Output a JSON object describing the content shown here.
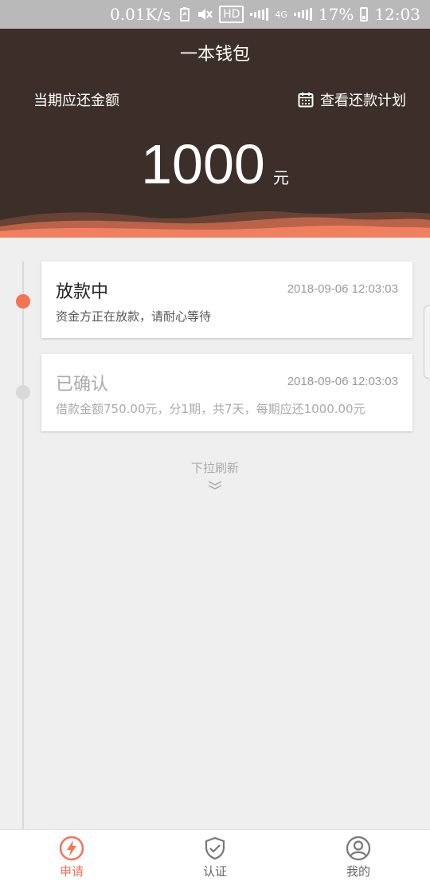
{
  "status_bar": {
    "speed": "0.01K/s",
    "hd": "HD",
    "network": "4G",
    "battery": "17%",
    "time": "12:03"
  },
  "header": {
    "title": "一本钱包",
    "current_label": "当期应还金额",
    "plan_label": "查看还款计划",
    "amount": "1000",
    "unit": "元"
  },
  "timeline": [
    {
      "title": "放款中",
      "time": "2018-09-06 12:03:03",
      "desc": "资金方正在放款，请耐心等待",
      "active": true
    },
    {
      "title": "已确认",
      "time": "2018-09-06 12:03:03",
      "desc": "借款金额750.00元，分1期，共7天，每期应还1000.00元",
      "active": false
    }
  ],
  "refresh_hint": "下拉刷新",
  "nav": [
    {
      "label": "申请",
      "icon": "lightning-icon",
      "active": true
    },
    {
      "label": "认证",
      "icon": "shield-check-icon",
      "active": false
    },
    {
      "label": "我的",
      "icon": "user-icon",
      "active": false
    }
  ],
  "colors": {
    "header_bg": "#3c2f29",
    "accent": "#f47355",
    "muted": "#aaaaaa"
  }
}
